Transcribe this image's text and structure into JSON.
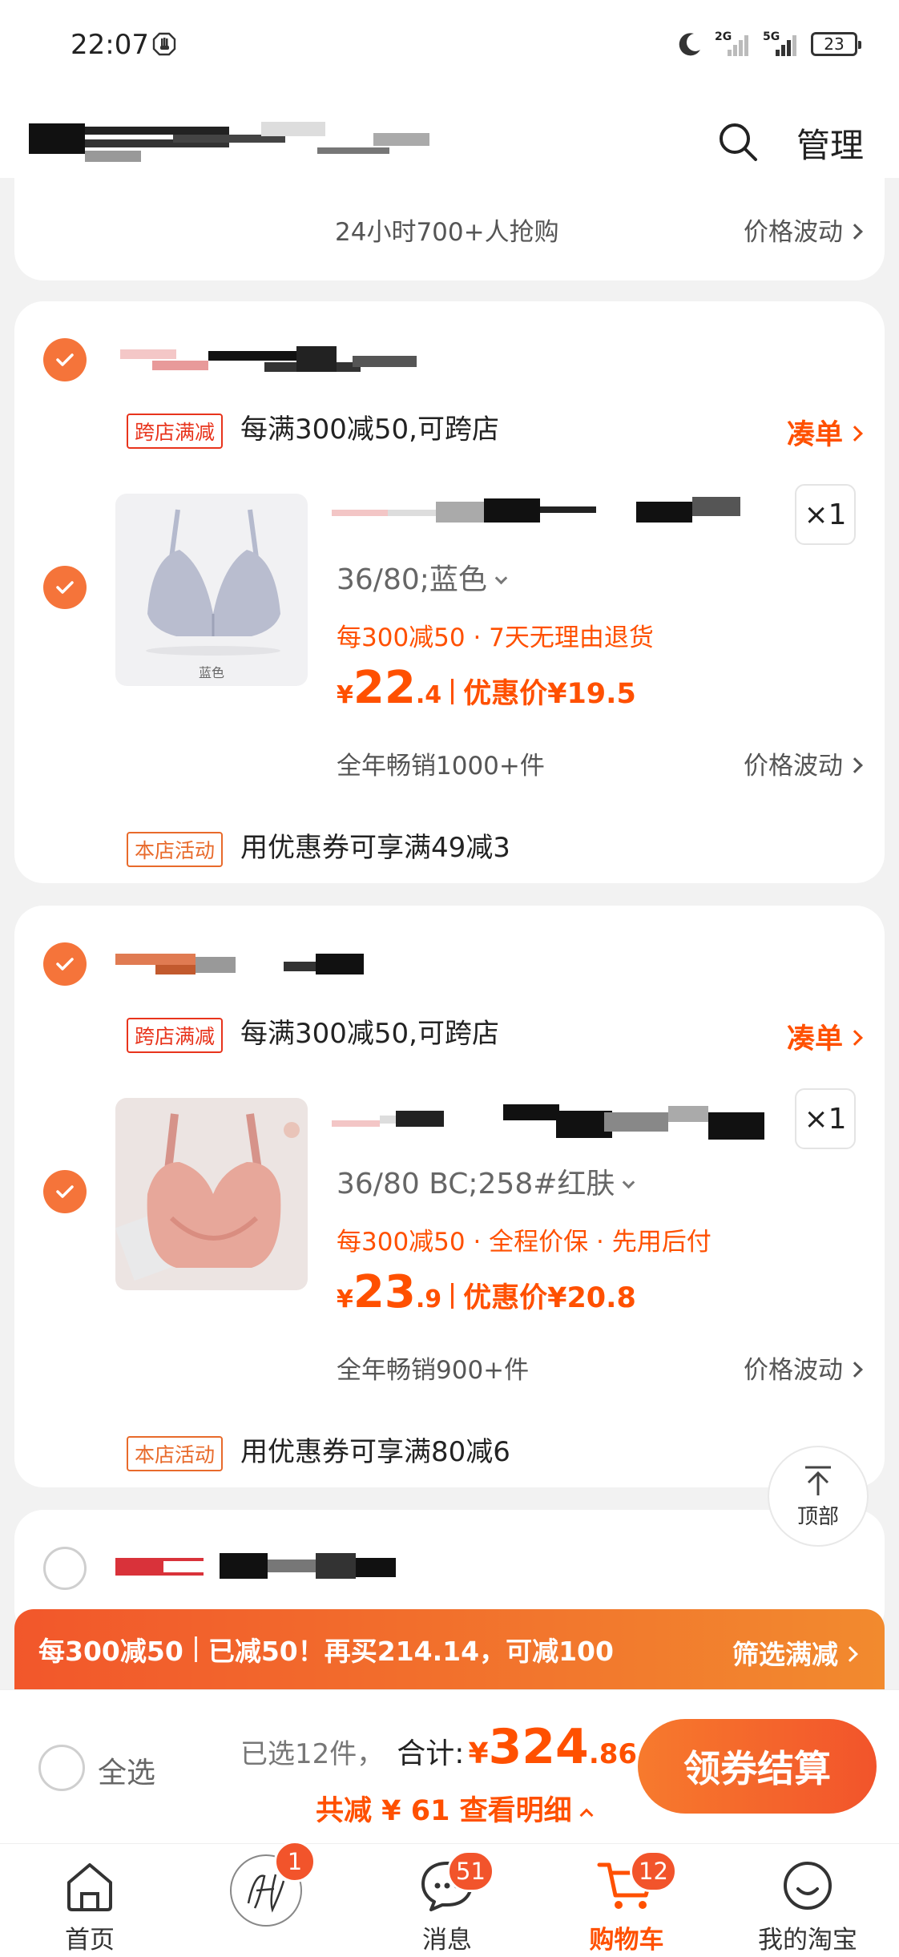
{
  "status_bar": {
    "time": "22:07",
    "net1": "2G",
    "net2": "5G",
    "battery": "23"
  },
  "header": {
    "manage_label": "管理"
  },
  "top_card": {
    "sales_text": "24小时700+人抢购",
    "price_wave": "价格波动"
  },
  "stores": [
    {
      "promo_tag": "跨店满减",
      "promo_text": "每满300减50,可跨店",
      "cou_dan": "凑单",
      "quantity": "×1",
      "sku": "36/80;蓝色",
      "benefits": "每300减50 · 7天无理由退货",
      "price_symbol": "¥",
      "price_int": "22",
      "price_dec": ".4",
      "discount": "优惠价¥19.5",
      "sales": "全年畅销1000+件",
      "price_wave": "价格波动",
      "activity_tag": "本店活动",
      "activity_text": "用优惠券可享满49减3",
      "thumb_caption": "蓝色",
      "thumb_color": "#b9bdcf"
    },
    {
      "promo_tag": "跨店满减",
      "promo_text": "每满300减50,可跨店",
      "cou_dan": "凑单",
      "quantity": "×1",
      "sku": "36/80 BC;258#红肤",
      "benefits": "每300减50 · 全程价保 · 先用后付",
      "price_symbol": "¥",
      "price_int": "23",
      "price_dec": ".9",
      "discount": "优惠价¥20.8",
      "sales": "全年畅销900+件",
      "price_wave": "价格波动",
      "activity_tag": "本店活动",
      "activity_text": "用优惠券可享满80减6",
      "thumb_color": "#e7a79a"
    }
  ],
  "back_to_top": "顶部",
  "banner": {
    "part1": "每300减50",
    "part2": "已减50！再买214.14，可减100",
    "filter": "筛选满减"
  },
  "checkout": {
    "select_all": "全选",
    "selected": "已选12件，",
    "total_label": "合计:",
    "total_symbol": "¥",
    "total_int": "324",
    "total_dec": ".86",
    "saved": "共减 ¥ 61  查看明细",
    "pay_button": "领券结算"
  },
  "tabs": [
    {
      "label": "首页",
      "icon": "home-icon"
    },
    {
      "label": "",
      "icon": "avatar-icon",
      "badge": "1"
    },
    {
      "label": "消息",
      "icon": "message-icon",
      "badge": "51"
    },
    {
      "label": "购物车",
      "icon": "cart-icon",
      "badge": "12",
      "active": true
    },
    {
      "label": "我的淘宝",
      "icon": "profile-icon"
    }
  ],
  "colors": {
    "accent": "#ff5000",
    "check": "#f5743a",
    "tag_red": "#e8341c"
  }
}
